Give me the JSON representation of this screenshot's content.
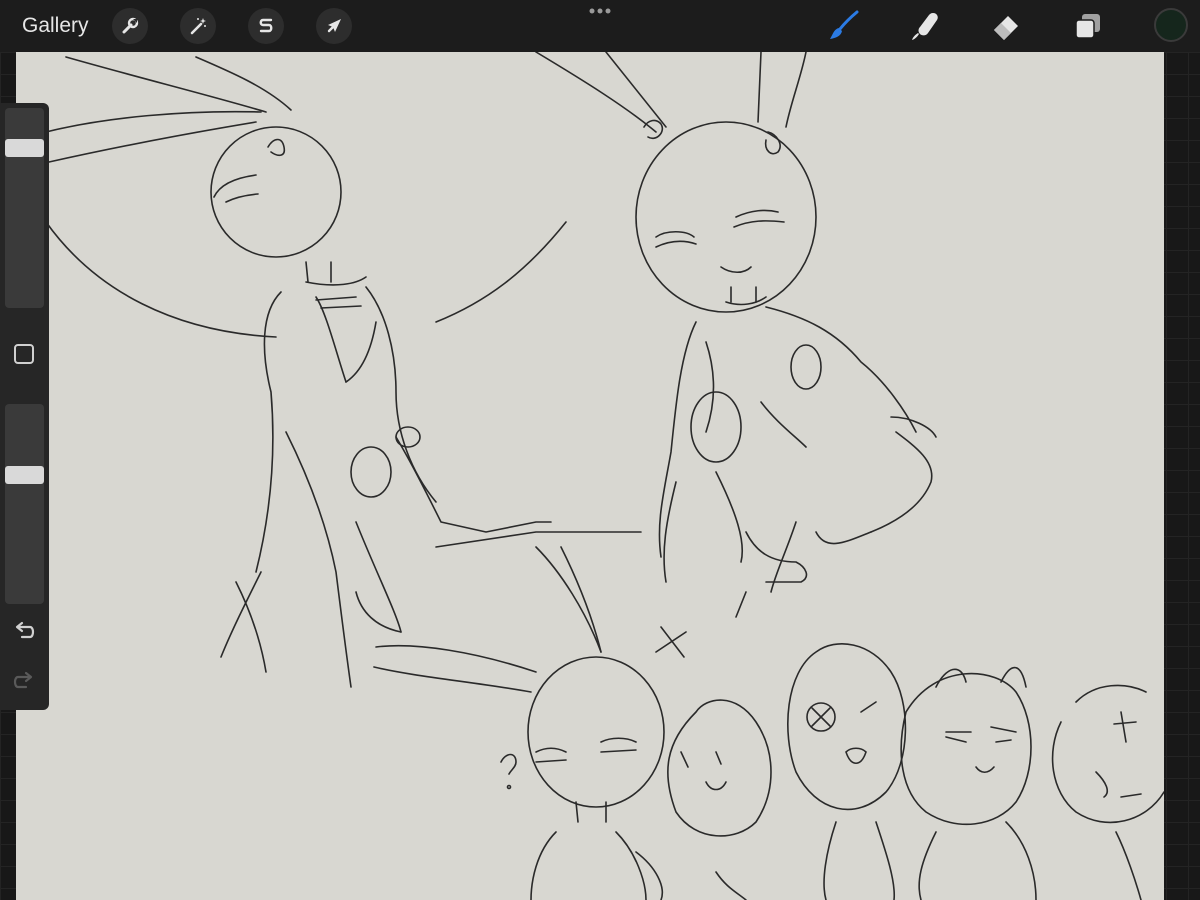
{
  "topbar": {
    "gallery_label": "Gallery",
    "left_tools": [
      {
        "icon": "wrench-icon",
        "name": "actions"
      },
      {
        "icon": "magic-wand-icon",
        "name": "adjustments"
      },
      {
        "icon": "selection-s-icon",
        "name": "selection"
      },
      {
        "icon": "arrow-cursor-icon",
        "name": "transform"
      }
    ],
    "more_menu_icon": "more-dots-icon",
    "right_tools": [
      {
        "icon": "brush-icon",
        "name": "brush",
        "active": true
      },
      {
        "icon": "smudge-icon",
        "name": "smudge",
        "active": false
      },
      {
        "icon": "eraser-icon",
        "name": "eraser",
        "active": false
      },
      {
        "icon": "layers-icon",
        "name": "layers",
        "active": false
      }
    ],
    "current_color": "#15261c"
  },
  "colors": {
    "active_tool": "#2b7be4",
    "canvas": "#d8d7d1",
    "ink": "#2a2a2a"
  },
  "sidebar": {
    "brush_size_icon": "brush-size-slider",
    "opacity_icon": "opacity-slider",
    "modify_icon": "square-modify-icon",
    "undo_icon": "undo-arrow-icon",
    "redo_icon": "redo-arrow-icon",
    "brush_size_level": 0.2,
    "opacity_level": 0.4
  }
}
